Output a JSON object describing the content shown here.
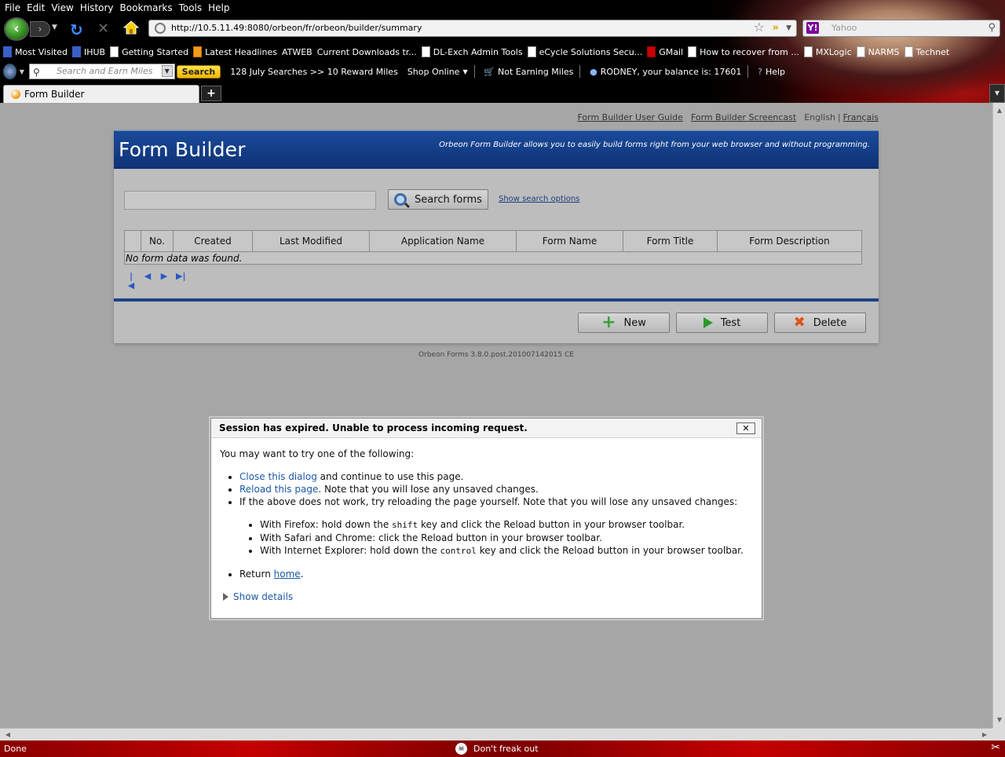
{
  "menu": [
    "File",
    "Edit",
    "View",
    "History",
    "Bookmarks",
    "Tools",
    "Help"
  ],
  "nav": {
    "url": "http://10.5.11.49:8080/orbeon/fr/orbeon/builder/summary",
    "search_placeholder": "Yahoo"
  },
  "bookmarks": [
    {
      "label": "Most Visited",
      "icon": "blue"
    },
    {
      "label": "IHUB",
      "icon": "blue"
    },
    {
      "label": "Getting Started",
      "icon": "page"
    },
    {
      "label": "Latest Headlines",
      "icon": "orange"
    },
    {
      "label": "ATWEB",
      "icon": "none"
    },
    {
      "label": "Current Downloads  tr...",
      "icon": "none"
    },
    {
      "label": "DL-Exch Admin Tools",
      "icon": "page"
    },
    {
      "label": "eCycle Solutions Secu...",
      "icon": "page"
    },
    {
      "label": "GMail",
      "icon": "red"
    },
    {
      "label": "How to recover from ...",
      "icon": "page"
    },
    {
      "label": "MXLogic",
      "icon": "page"
    },
    {
      "label": "NARMS",
      "icon": "page"
    },
    {
      "label": "Technet",
      "icon": "page"
    }
  ],
  "toolbar2": {
    "search_placeholder": "Search and Earn Miles",
    "search_button": "Search",
    "july": "128 July Searches >> 10 Reward Miles",
    "shop": "Shop Online",
    "not_earning": "Not Earning Miles",
    "balance": "RODNEY, your balance is:  17601",
    "help": "Help"
  },
  "tab": {
    "title": "Form Builder"
  },
  "page": {
    "links": {
      "guide": "Form Builder User Guide",
      "screencast": "Form Builder Screencast",
      "english": "English",
      "francais": "Français"
    },
    "title": "Form Builder",
    "tagline": "Orbeon Form Builder allows you to easily build forms right from your web browser and without programming.",
    "search_button": "Search forms",
    "search_options": "Show search options",
    "columns": [
      "",
      "No.",
      "Created",
      "Last Modified",
      "Application Name",
      "Form Name",
      "Form Title",
      "Form Description"
    ],
    "empty_message": "No form data was found.",
    "buttons": {
      "new": "New",
      "test": "Test",
      "delete": "Delete"
    },
    "version": "Orbeon Forms 3.8.0.post.201007142015 CE"
  },
  "dialog": {
    "title": "Session has expired. Unable to process incoming request.",
    "close": "✕",
    "intro": "You may want to try one of the following:",
    "close_link": "Close this dialog",
    "close_rest": " and continue to use this page.",
    "reload_link": "Reload this page",
    "reload_rest": ". Note that you will lose any unsaved changes.",
    "manual": "If the above does not work, try reloading the page yourself. Note that you will lose any unsaved changes:",
    "ff_pre": "With Firefox: hold down the ",
    "ff_key": "shift",
    "ff_post": " key and click the Reload button in your browser toolbar.",
    "safari": "With Safari and Chrome: click the Reload button in your browser toolbar.",
    "ie_pre": "With Internet Explorer: hold down the ",
    "ie_key": "control",
    "ie_post": " key and click the Reload button in your browser toolbar.",
    "return_pre": "Return ",
    "return_link": "home",
    "return_post": ".",
    "details": "Show details"
  },
  "status": {
    "left": "Done",
    "center": "Don't freak out"
  }
}
